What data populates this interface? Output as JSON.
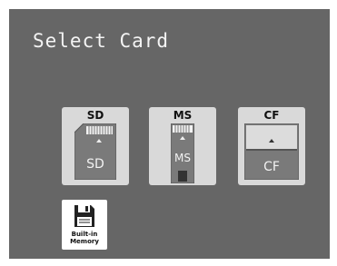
{
  "screen": {
    "title": "Select Card",
    "background": "#666666"
  },
  "cards": [
    {
      "label": "SD",
      "body_text": "SD",
      "icon": "sd-card-icon"
    },
    {
      "label": "MS",
      "body_text": "MS",
      "icon": "memory-stick-icon"
    },
    {
      "label": "CF",
      "body_text": "CF",
      "icon": "compact-flash-icon"
    }
  ],
  "builtin": {
    "line1": "Built-in",
    "line2": "Memory",
    "icon": "floppy-disk-icon"
  }
}
